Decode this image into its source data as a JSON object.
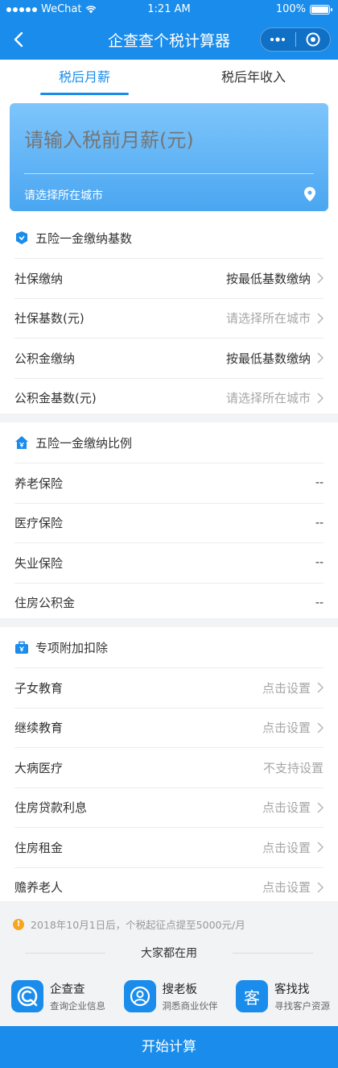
{
  "status_bar": {
    "carrier": "WeChat",
    "time": "1:21 AM",
    "battery": "100%"
  },
  "nav": {
    "title": "企查查个税计算器"
  },
  "tabs": [
    {
      "label": "税后月薪",
      "active": true
    },
    {
      "label": "税后年收入",
      "active": false
    }
  ],
  "hero": {
    "salary_placeholder": "请输入税前月薪(元)",
    "city_label": "请选择所在城市"
  },
  "base_section": {
    "title": "五险一金缴纳基数",
    "rows": [
      {
        "label": "社保缴纳",
        "value": "按最低基数缴纳"
      },
      {
        "label": "社保基数(元)",
        "value": "请选择所在城市"
      },
      {
        "label": "公积金缴纳",
        "value": "按最低基数缴纳"
      },
      {
        "label": "公积金基数(元)",
        "value": "请选择所在城市"
      }
    ]
  },
  "ratio_section": {
    "title": "五险一金缴纳比例",
    "rows": [
      {
        "label": "养老保险",
        "value": "--"
      },
      {
        "label": "医疗保险",
        "value": "--"
      },
      {
        "label": "失业保险",
        "value": "--"
      },
      {
        "label": "住房公积金",
        "value": "--"
      }
    ]
  },
  "deduction_section": {
    "title": "专项附加扣除",
    "rows": [
      {
        "label": "子女教育",
        "value": "点击设置"
      },
      {
        "label": "继续教育",
        "value": "点击设置"
      },
      {
        "label": "大病医疗",
        "value": "不支持设置"
      },
      {
        "label": "住房贷款利息",
        "value": "点击设置"
      },
      {
        "label": "住房租金",
        "value": "点击设置"
      },
      {
        "label": "赡养老人",
        "value": "点击设置"
      }
    ]
  },
  "notice": "2018年10月1日后，个税起征点提至5000元/月",
  "everyone_uses": "大家都在用",
  "apps": [
    {
      "name": "企查查",
      "desc": "查询企业信息",
      "icon": "qichacha-icon"
    },
    {
      "name": "搜老板",
      "desc": "洞悉商业伙伴",
      "icon": "soulaoban-icon"
    },
    {
      "name": "客找找",
      "desc": "寻找客户资源",
      "icon": "kezhaozhao-icon"
    }
  ],
  "start_button": "开始计算",
  "colors": {
    "primary": "#1a8ceb",
    "hero_top": "#7ec5fb",
    "hero_bottom": "#4aa6f1",
    "warning": "#f5a623"
  }
}
